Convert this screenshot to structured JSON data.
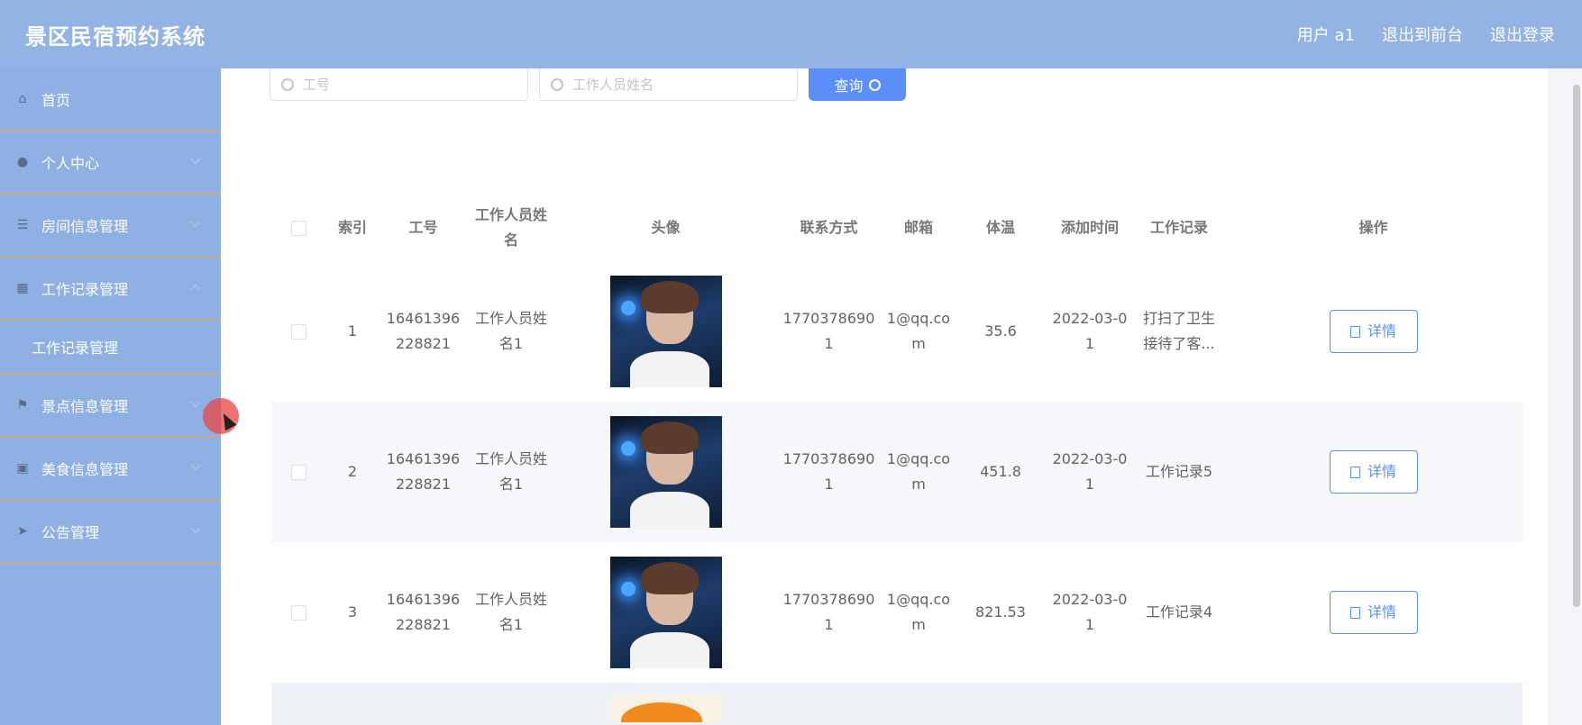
{
  "app": {
    "title": "景区民宿预约系统"
  },
  "topbar": {
    "user_label": "用户 a1",
    "back_label": "退出到前台",
    "logout_label": "退出登录"
  },
  "sidebar": {
    "items": [
      {
        "label": "首页",
        "icon": "home-icon"
      },
      {
        "label": "个人中心",
        "icon": "user-icon"
      },
      {
        "label": "房间信息管理",
        "icon": "list-icon"
      },
      {
        "label": "工作记录管理",
        "icon": "calendar-icon"
      },
      {
        "label": "景点信息管理",
        "icon": "flag-icon"
      },
      {
        "label": "美食信息管理",
        "icon": "briefcase-icon"
      },
      {
        "label": "公告管理",
        "icon": "send-icon"
      }
    ],
    "submenu": {
      "label": "工作记录管理"
    }
  },
  "search": {
    "no_placeholder": "工号",
    "name_placeholder": "工作人员姓名",
    "query_label": "查询"
  },
  "table": {
    "headers": {
      "index": "索引",
      "no": "工号",
      "name": "工作人员姓名",
      "avatar": "头像",
      "phone": "联系方式",
      "email": "邮箱",
      "temp": "体温",
      "time": "添加时间",
      "record": "工作记录",
      "op": "操作"
    },
    "rows": [
      {
        "index": "1",
        "no": "16461396228821",
        "name": "工作人员姓名1",
        "phone": "17703786901",
        "email": "1@qq.com",
        "temp": "35.6",
        "time": "2022-03-01",
        "record": "打扫了卫生 接待了客...",
        "detail": "详情"
      },
      {
        "index": "2",
        "no": "16461396228821",
        "name": "工作人员姓名1",
        "phone": "17703786901",
        "email": "1@qq.com",
        "temp": "451.8",
        "time": "2022-03-01",
        "record": "工作记录5",
        "detail": "详情"
      },
      {
        "index": "3",
        "no": "16461396228821",
        "name": "工作人员姓名1",
        "phone": "17703786901",
        "email": "1@qq.com",
        "temp": "821.53",
        "time": "2022-03-01",
        "record": "工作记录4",
        "detail": "详情"
      }
    ]
  },
  "colors": {
    "topbar": "#93b3e4",
    "sidebar": "#8fb0e2",
    "accent": "#5b8ef7",
    "divider": "#c9a987"
  }
}
